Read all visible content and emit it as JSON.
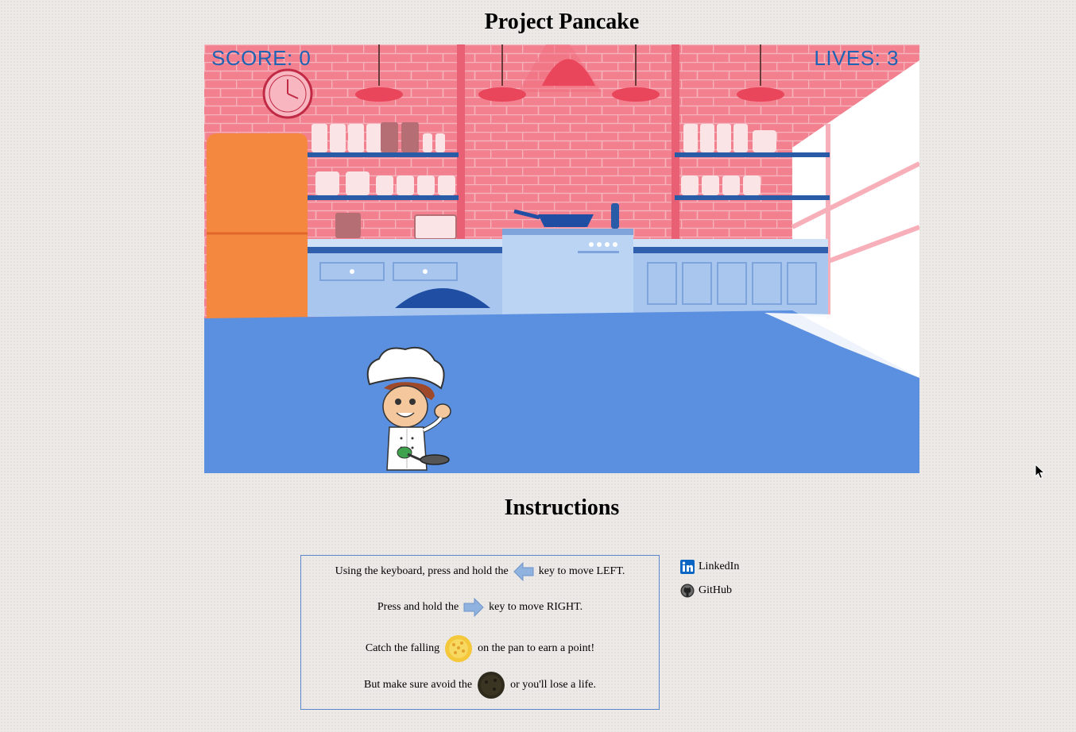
{
  "page": {
    "title": "Project Pancake"
  },
  "hud": {
    "score": "SCORE: 0",
    "lives": "LIVES: 3"
  },
  "instructions": {
    "title": "Instructions",
    "line1_before": "Using the keyboard, press and hold the",
    "line1_after": "key to move LEFT.",
    "line2_before": "Press and hold the",
    "line2_after": "key to move RIGHT.",
    "line3_before": "Catch the falling",
    "line3_after": "on the pan to earn a point!",
    "line4_before": "But make sure avoid the",
    "line4_after": "or you'll lose a life."
  },
  "links": {
    "linkedin": "LinkedIn",
    "github": "GitHub"
  },
  "colors": {
    "hud": "#1f64b4",
    "brick": "#f27f8e",
    "floor": "#5b8fdf",
    "fridge": "#f5883f"
  },
  "icons": [
    "left-arrow-icon",
    "right-arrow-icon",
    "pancake-icon",
    "burnt-pancake-icon",
    "linkedin-icon",
    "github-icon",
    "clock-icon",
    "chef-sprite"
  ]
}
